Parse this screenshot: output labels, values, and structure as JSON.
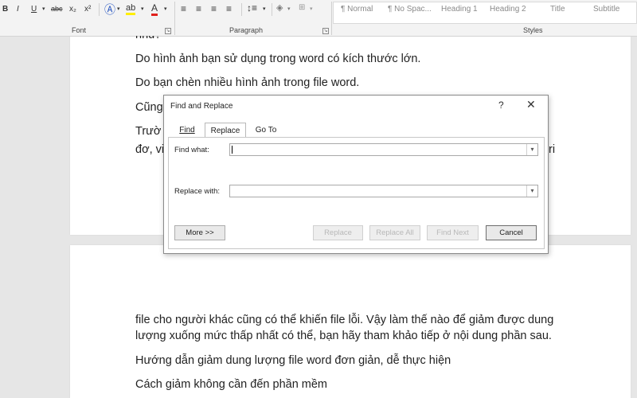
{
  "ribbon": {
    "font_buttons": [
      "B",
      "I",
      "U",
      "abc",
      "x₂",
      "x²"
    ],
    "font_label": "Font",
    "paragraph_label": "Paragraph",
    "styles_label": "Styles",
    "styles": [
      "¶ Normal",
      "¶ No Spac...",
      "Heading 1",
      "Heading 2",
      "Title",
      "Subtitle"
    ]
  },
  "document": {
    "page1_lines": [
      "nhu?",
      "Do hình ảnh bạn sử dụng trong word có kích thước lớn.",
      "Do bạn chèn nhiều hình ảnh trong file word.",
      "Cũng",
      "Trườ",
      "đơ, vi",
      "ri"
    ],
    "page2_lines": [
      "file cho người khác cũng có thể khiến file lỗi. Vậy làm thế nào để giảm được dung",
      "lượng xuống mức thấp nhất có thể, bạn hãy tham khảo tiếp ở nội dung phần sau.",
      "Hướng dẫn giảm dung lượng file word đơn giản, dễ thực hiện",
      "Cách giảm không cần đến phần mềm"
    ]
  },
  "dialog": {
    "title": "Find and Replace",
    "help": "?",
    "close": "✕",
    "tabs": [
      "Find",
      "Replace",
      "Go To"
    ],
    "find_label": "Find what:",
    "find_value": "",
    "replace_label": "Replace with:",
    "replace_value": "",
    "buttons": {
      "more": "More >>",
      "replace": "Replace",
      "replace_all": "Replace All",
      "find_next": "Find Next",
      "cancel": "Cancel"
    }
  }
}
